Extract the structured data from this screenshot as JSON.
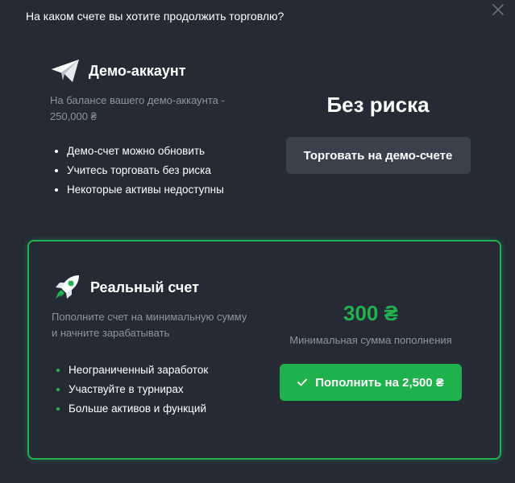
{
  "modal": {
    "title": "На каком счете вы хотите продолжить торговлю?",
    "close_icon": "close-icon"
  },
  "demo": {
    "icon": "paper-plane-icon",
    "title": "Демо-аккаунт",
    "description": "На балансе вашего демо-аккаунта - 250,000 ₴",
    "features": [
      "Демо-счет можно обновить",
      "Учитесь торговать без риска",
      "Некоторые активы недоступны"
    ],
    "headline": "Без риска",
    "button_label": "Торговать на демо-счете"
  },
  "real": {
    "icon": "rocket-icon",
    "title": "Реальный счет",
    "description": "Пополните счет на минимальную сумму и начните зарабатывать",
    "features": [
      "Неограниченный заработок",
      "Участвуйте в турнирах",
      "Больше активов и функций"
    ],
    "amount": "300 ₴",
    "amount_label": "Минимальная сумма пополнения",
    "button_icon": "check-icon",
    "button_label": "Пополнить на 2,500 ₴"
  },
  "colors": {
    "background": "#252a35",
    "accent_green": "#22b14f",
    "muted_text": "#8e94a3",
    "button_gray": "#3b404d"
  }
}
